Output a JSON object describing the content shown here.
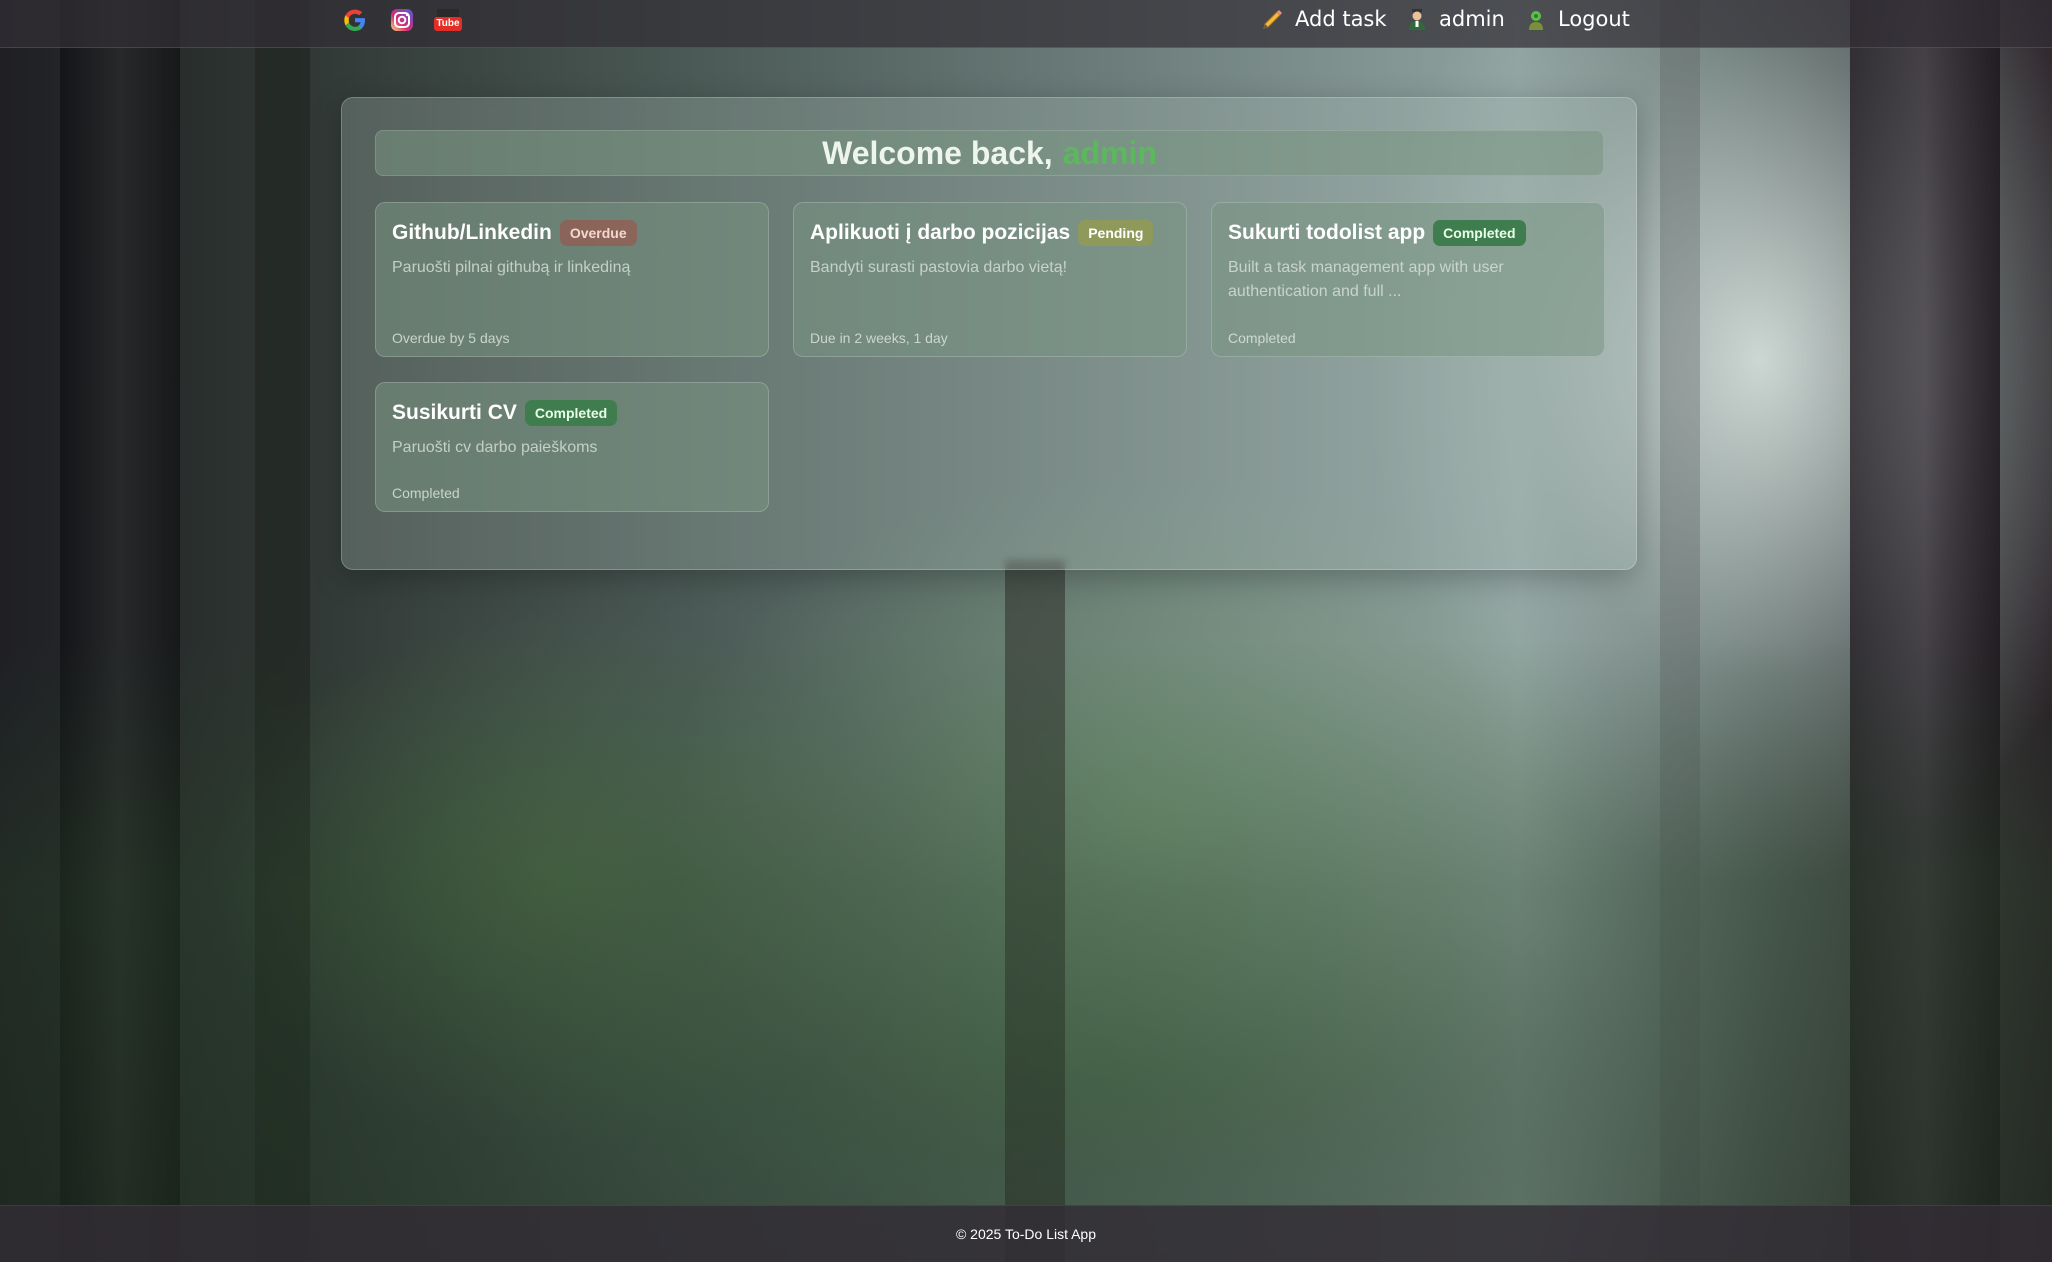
{
  "nav": {
    "social": [
      {
        "name": "google-icon",
        "color": "#4285F4"
      },
      {
        "name": "instagram-icon",
        "color": "#C13584"
      },
      {
        "name": "youtube-icon",
        "color": "#E52D27"
      }
    ],
    "youtube_text": "Tube",
    "add_task_label": "Add task",
    "user_label": "admin",
    "logout_label": "Logout"
  },
  "welcome": {
    "prefix": "Welcome back,",
    "username": "admin"
  },
  "tasks": [
    {
      "title": "Github/Linkedin",
      "badge": "Overdue",
      "description": "Paruošti pilnai githubą ir linkediną",
      "status_text": "Overdue by 5 days"
    },
    {
      "title": "Aplikuoti į darbo pozicijas",
      "badge": "Pending",
      "description": "Bandyti surasti pastovia darbo vietą!",
      "status_text": "Due in 2 weeks, 1 day"
    },
    {
      "title": "Sukurti todolist app",
      "badge": "Completed",
      "description": "Built a task management app with user authentication and full ...",
      "status_text": "Completed"
    },
    {
      "title": "Susikurti CV",
      "badge": "Completed",
      "description": "Paruošti cv darbo paieškoms",
      "status_text": "Completed"
    }
  ],
  "footer": {
    "text": "© 2025 To-Do List App"
  },
  "colors": {
    "accent_username": "#5cb85c",
    "badge_overdue": "#965a50",
    "badge_pending": "#8f9a5a",
    "badge_completed": "#3f7d4f"
  }
}
